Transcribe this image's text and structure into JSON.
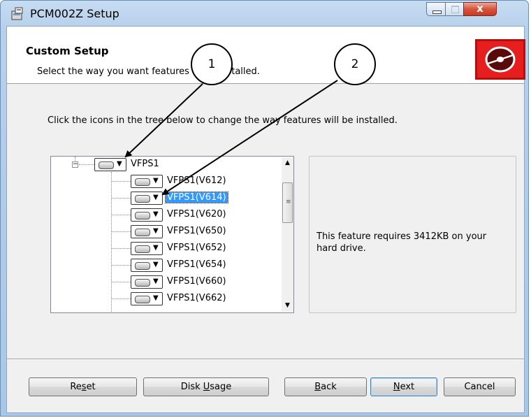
{
  "window": {
    "title": "PCM002Z Setup",
    "close_glyph": "x"
  },
  "banner": {
    "title": "Custom Setup",
    "subtitle": "Select the way you want features to be installed.",
    "logo_icon": "disc-icon"
  },
  "instruction": "Click the icons in the tree below to change the way features will be installed.",
  "tree": {
    "root": {
      "label": "VFPS1"
    },
    "children": [
      {
        "label": "VFPS1(V612)",
        "selected": false
      },
      {
        "label": "VFPS1(V614)",
        "selected": true
      },
      {
        "label": "VFPS1(V620)",
        "selected": false
      },
      {
        "label": "VFPS1(V650)",
        "selected": false
      },
      {
        "label": "VFPS1(V652)",
        "selected": false
      },
      {
        "label": "VFPS1(V654)",
        "selected": false
      },
      {
        "label": "VFPS1(V660)",
        "selected": false
      },
      {
        "label": "VFPS1(V662)",
        "selected": false
      }
    ]
  },
  "info": {
    "description": "This feature requires 3412KB on your hard drive."
  },
  "buttons": {
    "reset": {
      "pre": "Re",
      "key": "s",
      "post": "et"
    },
    "disk_usage": {
      "pre": "Disk ",
      "key": "U",
      "post": "sage"
    },
    "back": {
      "pre": "",
      "key": "B",
      "post": "ack"
    },
    "next": {
      "pre": "",
      "key": "N",
      "post": "ext"
    },
    "cancel": {
      "pre": "Cancel",
      "key": "",
      "post": ""
    }
  },
  "callouts": [
    {
      "number": "1"
    },
    {
      "number": "2"
    }
  ],
  "colors": {
    "selection": "#3399ff",
    "logo_red": "#e61e1e",
    "close_red": "#c63a22"
  }
}
